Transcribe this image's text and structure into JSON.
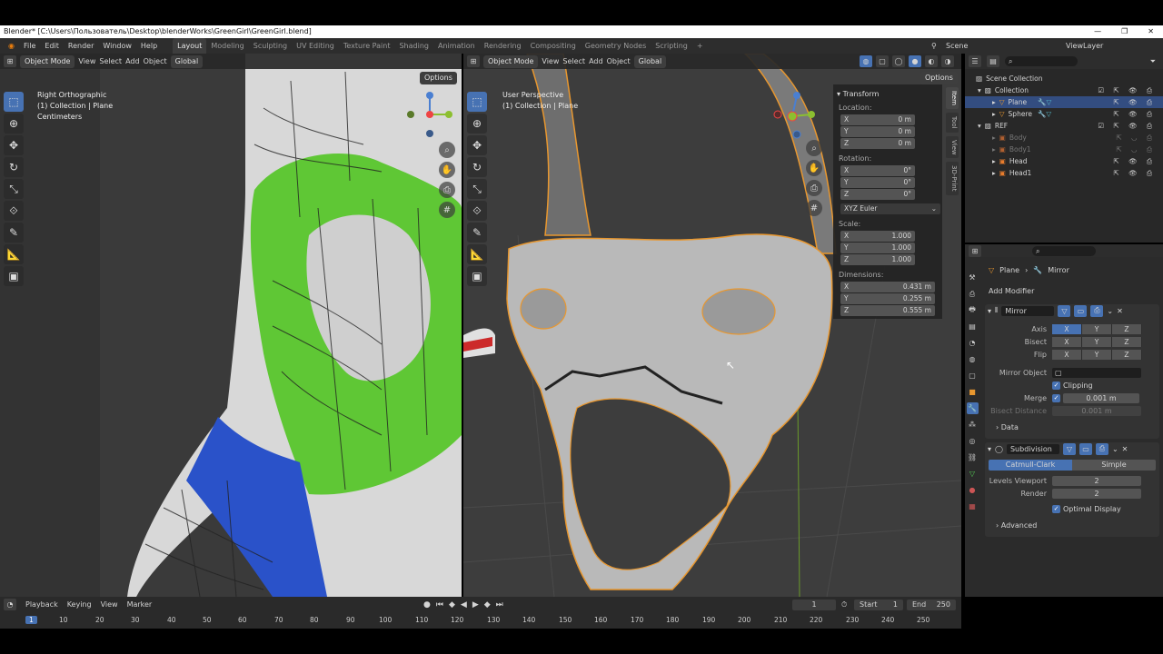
{
  "window": {
    "title": "Blender* [C:\\Users\\Пользователь\\Desktop\\blenderWorks\\GreenGirl\\GreenGirl.blend]"
  },
  "menu": {
    "items": [
      "File",
      "Edit",
      "Render",
      "Window",
      "Help"
    ]
  },
  "workspaces": [
    "Layout",
    "Modeling",
    "Sculpting",
    "UV Editing",
    "Texture Paint",
    "Shading",
    "Animation",
    "Rendering",
    "Compositing",
    "Geometry Nodes",
    "Scripting",
    "+"
  ],
  "scene": {
    "name": "Scene",
    "viewlayer": "ViewLayer"
  },
  "left_view": {
    "mode": "Object Mode",
    "menus": [
      "View",
      "Select",
      "Add",
      "Object"
    ],
    "transform": "Global",
    "options": "Options",
    "info": [
      "Right Orthographic",
      "(1) Collection | Plane",
      "Centimeters"
    ]
  },
  "right_view": {
    "mode": "Object Mode",
    "menus": [
      "View",
      "Select",
      "Add",
      "Object"
    ],
    "transform": "Global",
    "options": "Options",
    "info": [
      "User Perspective",
      "(1) Collection | Plane"
    ]
  },
  "npanel": {
    "title": "Transform",
    "location_label": "Location:",
    "location": [
      {
        "axis": "X",
        "value": "0 m"
      },
      {
        "axis": "Y",
        "value": "0 m"
      },
      {
        "axis": "Z",
        "value": "0 m"
      }
    ],
    "rotation_label": "Rotation:",
    "rotation": [
      {
        "axis": "X",
        "value": "0°"
      },
      {
        "axis": "Y",
        "value": "0°"
      },
      {
        "axis": "Z",
        "value": "0°"
      }
    ],
    "rotation_mode": "XYZ Euler",
    "scale_label": "Scale:",
    "scale": [
      {
        "axis": "X",
        "value": "1.000"
      },
      {
        "axis": "Y",
        "value": "1.000"
      },
      {
        "axis": "Z",
        "value": "1.000"
      }
    ],
    "dimensions_label": "Dimensions:",
    "dimensions": [
      {
        "axis": "X",
        "value": "0.431 m"
      },
      {
        "axis": "Y",
        "value": "0.255 m"
      },
      {
        "axis": "Z",
        "value": "0.555 m"
      }
    ],
    "tabs": [
      "Item",
      "Tool",
      "View",
      "3D-Print"
    ]
  },
  "outliner": {
    "rows": [
      {
        "name": "Scene Collection"
      },
      {
        "name": "Collection"
      },
      {
        "name": "Plane"
      },
      {
        "name": "Sphere"
      },
      {
        "name": "REF"
      },
      {
        "name": "Body"
      },
      {
        "name": "Body1"
      },
      {
        "name": "Head"
      },
      {
        "name": "Head1"
      }
    ]
  },
  "properties": {
    "breadcrumb": [
      "Plane",
      "Mirror"
    ],
    "add_modifier": "Add Modifier",
    "mirror": {
      "name": "Mirror",
      "axis_label": "Axis",
      "bisect_label": "Bisect",
      "flip_label": "Flip",
      "xyz": [
        "X",
        "Y",
        "Z"
      ],
      "mirror_object_label": "Mirror Object",
      "clipping": "Clipping",
      "merge_label": "Merge",
      "merge_value": "0.001 m",
      "bisect_distance_label": "Bisect Distance",
      "bisect_distance_value": "0.001 m",
      "data": "Data"
    },
    "subdivision": {
      "name": "Subdivision",
      "catmull": "Catmull-Clark",
      "simple": "Simple",
      "levels_viewport_label": "Levels Viewport",
      "levels_viewport": "2",
      "render_label": "Render",
      "render": "2",
      "optimal": "Optimal Display",
      "advanced": "Advanced"
    }
  },
  "timeline": {
    "menus": [
      "Playback",
      "Keying",
      "View",
      "Marker"
    ],
    "current": "1",
    "start_label": "Start",
    "start": "1",
    "end_label": "End",
    "end": "250",
    "ticks": [
      "1",
      "10",
      "20",
      "30",
      "40",
      "50",
      "60",
      "70",
      "80",
      "90",
      "100",
      "110",
      "120",
      "130",
      "140",
      "150",
      "160",
      "170",
      "180",
      "190",
      "200",
      "210",
      "220",
      "230",
      "240",
      "250"
    ]
  }
}
